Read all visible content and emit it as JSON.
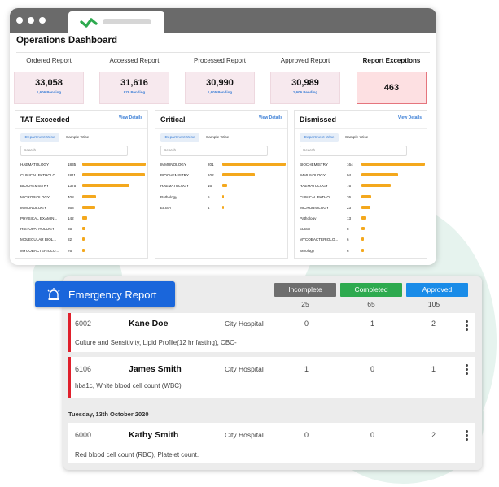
{
  "app": {
    "title": "Operations Dashboard"
  },
  "stats": [
    {
      "label": "Ordered Report",
      "value": "33,058",
      "pending": "1,606 Pending"
    },
    {
      "label": "Accessed Report",
      "value": "31,616",
      "pending": "979 Pending"
    },
    {
      "label": "Processed Report",
      "value": "30,990",
      "pending": "1,605 Pending"
    },
    {
      "label": "Approved Report",
      "value": "30,989",
      "pending": "1,606 Pending"
    },
    {
      "label": "Report Exceptions",
      "value": "463",
      "pending": ""
    }
  ],
  "cards": [
    {
      "title": "TAT Exceeded",
      "view_details": "View Details",
      "tab_active": "Department Wise",
      "tab_other": "Sample Wise",
      "search_placeholder": "Search",
      "rows": [
        {
          "dept": "HAEMATOLOGY",
          "count": 1835
        },
        {
          "dept": "CLINICAL PATHOLO...",
          "count": 1811
        },
        {
          "dept": "BIOCHEMISTRY",
          "count": 1375
        },
        {
          "dept": "MICROBIOLOGY",
          "count": 408
        },
        {
          "dept": "IMMUNOLOGY",
          "count": 368
        },
        {
          "dept": "PHYSICAL EXAMIN...",
          "count": 142
        },
        {
          "dept": "HISTOPATHOLOGY",
          "count": 85
        },
        {
          "dept": "MOLECULAR BIOL...",
          "count": 82
        },
        {
          "dept": "MYCOBACTERIOLO...",
          "count": 76
        }
      ]
    },
    {
      "title": "Critical",
      "view_details": "View Details",
      "tab_active": "Department Wise",
      "tab_other": "Sample Wise",
      "search_placeholder": "Search",
      "rows": [
        {
          "dept": "IMMUNOLOGY",
          "count": 201
        },
        {
          "dept": "BIOCHEMISTRY",
          "count": 102
        },
        {
          "dept": "HAEMATOLOGY",
          "count": 16
        },
        {
          "dept": "Pathology",
          "count": 5
        },
        {
          "dept": "ELISA",
          "count": 4
        }
      ]
    },
    {
      "title": "Dismissed",
      "view_details": "View Details",
      "tab_active": "Department Wise",
      "tab_other": "Sample Wise",
      "search_placeholder": "Search",
      "rows": [
        {
          "dept": "BIOCHEMISTRY",
          "count": 164
        },
        {
          "dept": "IMMUNOLOGY",
          "count": 94
        },
        {
          "dept": "HAEMATOLOGY",
          "count": 75
        },
        {
          "dept": "CLINICAL PATHOL...",
          "count": 26
        },
        {
          "dept": "MICROBIOLOGY",
          "count": 23
        },
        {
          "dept": "Pathology",
          "count": 13
        },
        {
          "dept": "ELISA",
          "count": 8
        },
        {
          "dept": "MYCOBACTERIOLO...",
          "count": 6
        },
        {
          "dept": "Serology",
          "count": 6
        }
      ]
    }
  ],
  "emergency": {
    "title": "Emergency Report",
    "statuses": [
      {
        "label": "Incomplete",
        "count": "25",
        "color": "#6e6e6e"
      },
      {
        "label": "Completed",
        "count": "65",
        "color": "#2eaa4f"
      },
      {
        "label": "Approved",
        "count": "105",
        "color": "#1a8ce8"
      }
    ],
    "date_label": "Tuesday, 13th October 2020",
    "entries": [
      {
        "id": "6002",
        "name": "Kane Doe",
        "hospital": "City Hospital",
        "incomplete": "0",
        "completed": "1",
        "approved": "2",
        "tests": "Culture and Sensitivity, Lipid Profile(12 hr fasting), CBC-"
      },
      {
        "id": "6106",
        "name": "James Smith",
        "hospital": "City Hospital",
        "incomplete": "1",
        "completed": "0",
        "approved": "1",
        "tests": "hba1c, White blood cell count (WBC)"
      },
      {
        "id": "6000",
        "name": "Kathy Smith",
        "hospital": "City Hospital",
        "incomplete": "0",
        "completed": "0",
        "approved": "2",
        "tests": "Red blood cell count (RBC), Platelet count."
      }
    ]
  },
  "colors": {
    "accent": "#1a66db",
    "bar": "#f4a81d",
    "alert": "#e0202c",
    "brand": "#2eaa4f"
  }
}
